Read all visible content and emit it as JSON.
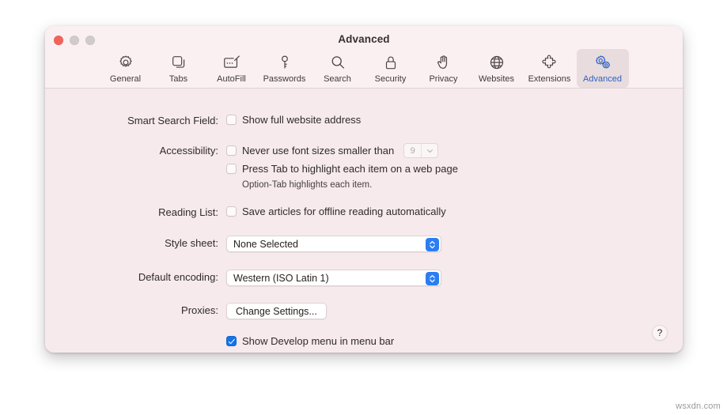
{
  "window": {
    "title": "Advanced",
    "traffic_lights": [
      {
        "name": "close",
        "color": "#f2635a"
      },
      {
        "name": "minimize",
        "color": "#d2cbcb"
      },
      {
        "name": "zoom",
        "color": "#d2cbcb"
      }
    ]
  },
  "toolbar": {
    "tabs": [
      {
        "label": "General",
        "icon": "gear-icon",
        "selected": false
      },
      {
        "label": "Tabs",
        "icon": "tabs-icon",
        "selected": false
      },
      {
        "label": "AutoFill",
        "icon": "autofill-icon",
        "selected": false
      },
      {
        "label": "Passwords",
        "icon": "key-icon",
        "selected": false
      },
      {
        "label": "Search",
        "icon": "magnifier-icon",
        "selected": false
      },
      {
        "label": "Security",
        "icon": "lock-icon",
        "selected": false
      },
      {
        "label": "Privacy",
        "icon": "hand-icon",
        "selected": false
      },
      {
        "label": "Websites",
        "icon": "globe-icon",
        "selected": false
      },
      {
        "label": "Extensions",
        "icon": "puzzle-icon",
        "selected": false
      },
      {
        "label": "Advanced",
        "icon": "double-gear-icon",
        "selected": true
      }
    ],
    "selected_color": "#2d62c4",
    "selected_background": "#e9dcde"
  },
  "settings": {
    "smart_search_field": {
      "label": "Smart Search Field:",
      "checkbox_label": "Show full website address",
      "checked": false
    },
    "accessibility": {
      "label": "Accessibility:",
      "font_size_checkbox_label": "Never use font sizes smaller than",
      "font_size_checked": false,
      "font_size_value": "9",
      "font_size_disabled": true,
      "press_tab_checkbox_label": "Press Tab to highlight each item on a web page",
      "press_tab_checked": false,
      "hint": "Option-Tab highlights each item."
    },
    "reading_list": {
      "label": "Reading List:",
      "checkbox_label": "Save articles for offline reading automatically",
      "checked": false
    },
    "style_sheet": {
      "label": "Style sheet:",
      "value": "None Selected"
    },
    "default_encoding": {
      "label": "Default encoding:",
      "value": "Western (ISO Latin 1)"
    },
    "proxies": {
      "label": "Proxies:",
      "button_label": "Change Settings..."
    },
    "develop_menu": {
      "checkbox_label": "Show Develop menu in menu bar",
      "checked": true
    }
  },
  "help": {
    "label": "?"
  },
  "watermark": {
    "text": "wsxdn.com"
  }
}
